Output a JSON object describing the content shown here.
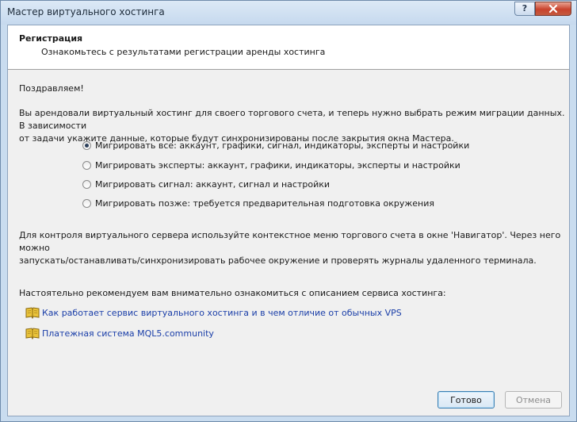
{
  "window": {
    "title": "Мастер виртуального хостинга",
    "help_label": "?"
  },
  "header": {
    "title": "Регистрация",
    "subtitle": "Ознакомьтесь с результатами регистрации аренды хостинга"
  },
  "body": {
    "greeting": "Поздравляем!",
    "intro_line1": "Вы арендовали виртуальный хостинг для своего торгового счета, и теперь нужно выбрать режим миграции данных. В зависимости",
    "intro_line2": "от задачи укажите данные, которые будут синхронизированы после закрытия окна Мастера.",
    "options": [
      {
        "label": "Мигрировать все: аккаунт, графики, сигнал, индикаторы, эксперты и настройки",
        "checked": true
      },
      {
        "label": "Мигрировать эксперты: аккаунт, графики, индикаторы, эксперты и настройки",
        "checked": false
      },
      {
        "label": "Мигрировать сигнал: аккаунт, сигнал и настройки",
        "checked": false
      },
      {
        "label": "Мигрировать позже: требуется предварительная подготовка окружения",
        "checked": false
      }
    ],
    "control_line1": "Для контроля виртуального сервера используйте контекстное меню торгового счета в окне 'Навигатор'. Через него можно",
    "control_line2": "запускать/останавливать/синхронизировать рабочее окружение и проверять журналы удаленного терминала.",
    "recommend": "Настоятельно рекомендуем вам внимательно ознакомиться с описанием сервиса хостинга:",
    "links": [
      {
        "label": "Как работает сервис виртуального хостинга и в чем отличие от обычных VPS",
        "icon": "book-icon"
      },
      {
        "label": "Платежная система MQL5.community",
        "icon": "book-icon"
      }
    ]
  },
  "buttons": {
    "ok": "Готово",
    "cancel": "Отмена"
  },
  "colors": {
    "link": "#1a3ea8",
    "accent": "#3c7fb1",
    "close": "#c9432d"
  }
}
